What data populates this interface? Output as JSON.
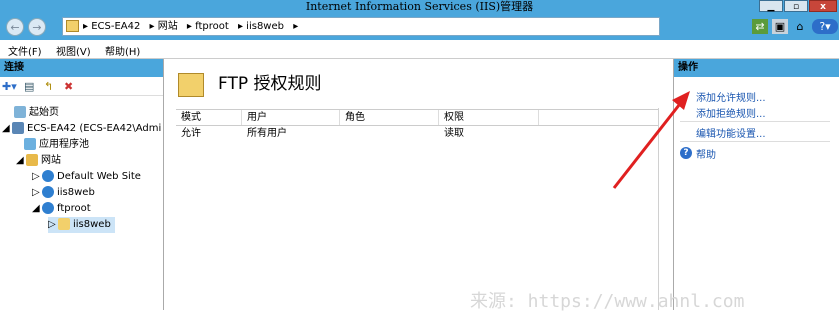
{
  "window": {
    "title": "Internet Information Services (IIS)管理器",
    "buttons": {
      "minimize": "▁",
      "restore": "▫",
      "close": "x"
    }
  },
  "address": {
    "crumbs": [
      "▸ ECS-EA42",
      "▸ 网站",
      "▸ ftproot",
      "▸ iis8web",
      "▸"
    ],
    "back_glyph": "←",
    "forward_glyph": "→"
  },
  "menu": {
    "file": "文件(F)",
    "view": "视图(V)",
    "help": "帮助(H)"
  },
  "connections": {
    "header": "连接",
    "tree": [
      {
        "label": "起始页"
      },
      {
        "label": "ECS-EA42 (ECS-EA42\\Admi"
      },
      {
        "label": "应用程序池"
      },
      {
        "label": "网站"
      },
      {
        "label": "Default Web Site"
      },
      {
        "label": "iis8web"
      },
      {
        "label": "ftproot"
      },
      {
        "label": "iis8web"
      }
    ]
  },
  "feature": {
    "title": "FTP 授权规则",
    "columns": [
      "模式",
      "用户",
      "角色",
      "权限"
    ],
    "rows": [
      {
        "mode": "允许",
        "user": "所有用户",
        "role": "",
        "permission": "读取"
      }
    ]
  },
  "actions": {
    "header": "操作",
    "add_allow": "添加允许规则...",
    "add_deny": "添加拒绝规则...",
    "edit_settings": "编辑功能设置...",
    "help": "帮助"
  },
  "watermark": "来源: https://www.ahnl.com",
  "colors": {
    "titlebar": "#4aa6dc",
    "link": "#1a56b0",
    "arrow": "#e02020"
  }
}
